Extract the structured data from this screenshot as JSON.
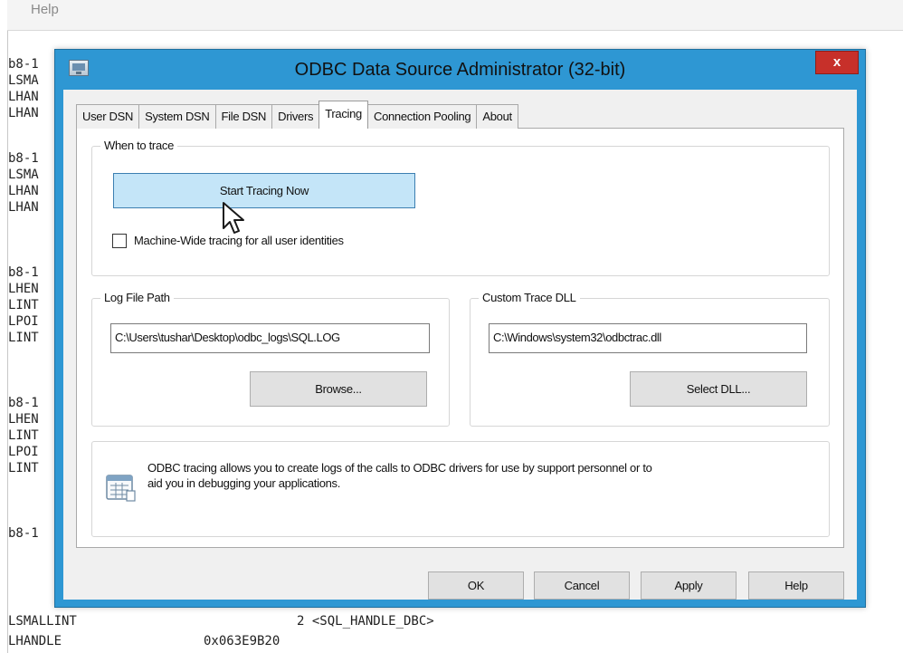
{
  "background_window": {
    "menu_help": "Help",
    "log_lines": [
      "b8-1",
      "LSMA",
      "LHAN",
      "LHAN",
      "b8-1",
      "LSMA",
      "LHAN",
      "LHAN",
      "b8-1",
      "LHEN",
      "LINT",
      "LPOI",
      "LINT",
      "b8-1",
      "LHEN",
      "LINT",
      "LPOI",
      "LINT",
      "b8-1"
    ],
    "bottom_rows": [
      {
        "type": "LSMALLINT",
        "value": "2 <SQL_HANDLE_DBC>"
      },
      {
        "type": "LHANDLE",
        "value": "0x063E9B20"
      }
    ]
  },
  "dialog": {
    "title": "ODBC Data Source Administrator (32-bit)",
    "close_symbol": "x",
    "tabs": [
      {
        "label": "User DSN",
        "active": false
      },
      {
        "label": "System DSN",
        "active": false
      },
      {
        "label": "File DSN",
        "active": false
      },
      {
        "label": "Drivers",
        "active": false
      },
      {
        "label": "Tracing",
        "active": true
      },
      {
        "label": "Connection Pooling",
        "active": false
      },
      {
        "label": "About",
        "active": false
      }
    ],
    "when_to_trace": {
      "label": "When to trace",
      "start_button": "Start Tracing Now",
      "machine_wide_checkbox_label": "Machine-Wide tracing for all user identities",
      "machine_wide_checked": false
    },
    "log_file_path": {
      "label": "Log File Path",
      "value": "C:\\Users\\tushar\\Desktop\\odbc_logs\\SQL.LOG",
      "browse_button": "Browse..."
    },
    "custom_trace_dll": {
      "label": "Custom Trace DLL",
      "value": "C:\\Windows\\system32\\odbctrac.dll",
      "select_button": "Select DLL..."
    },
    "info_text": "ODBC tracing allows you to create logs of the calls to ODBC drivers for use by support personnel or to aid you in debugging your applications.",
    "info_text_line1": "ODBC tracing allows you to create logs of the calls to ODBC drivers for use by support personnel or to",
    "info_text_line2": "aid you in debugging your applications.",
    "footer_buttons": {
      "ok": "OK",
      "cancel": "Cancel",
      "apply": "Apply",
      "help": "Help"
    }
  },
  "colors": {
    "title_bar": "#2e97d3",
    "close_button": "#c7302a",
    "primary_button": "#c4e5f8"
  }
}
